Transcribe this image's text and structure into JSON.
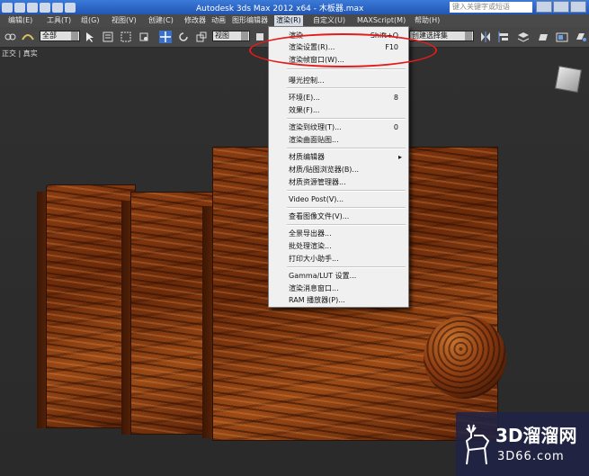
{
  "title_bar": {
    "app_title": "Autodesk 3ds Max  2012 x64     - 木板器.max",
    "search_placeholder": "键入关键字或短语"
  },
  "menu_bar": {
    "items": [
      "编辑(E)",
      "工具(T)",
      "组(G)",
      "视图(V)",
      "创建(C)",
      "修改器",
      "动画",
      "图形编辑器",
      "渲染(R)",
      "自定义(U)",
      "MAXScript(M)",
      "帮助(H)"
    ],
    "active": "渲染(R)"
  },
  "toolbar": {
    "selection_filter": "全部",
    "reference_coord": "视图",
    "named_selection": "创建选择集"
  },
  "viewport": {
    "label": "正交 | 真实"
  },
  "render_menu": {
    "groups": [
      [
        {
          "label": "渲染",
          "shortcut": "Shift+Q"
        },
        {
          "label": "渲染设置(R)...",
          "shortcut": "F10"
        },
        {
          "label": "渲染帧窗口(W)...",
          "shortcut": ""
        }
      ],
      [
        {
          "label": "曝光控制...",
          "shortcut": ""
        }
      ],
      [
        {
          "label": "环境(E)...",
          "shortcut": "8"
        },
        {
          "label": "效果(F)...",
          "shortcut": ""
        }
      ],
      [
        {
          "label": "渲染到纹理(T)...",
          "shortcut": "0"
        },
        {
          "label": "渲染曲面贴图...",
          "shortcut": ""
        }
      ],
      [
        {
          "label": "材质编辑器",
          "shortcut": "",
          "submenu": true
        },
        {
          "label": "材质/贴图浏览器(B)...",
          "shortcut": ""
        },
        {
          "label": "材质资源管理器...",
          "shortcut": ""
        }
      ],
      [
        {
          "label": "Video Post(V)...",
          "shortcut": ""
        }
      ],
      [
        {
          "label": "查看图像文件(V)...",
          "shortcut": ""
        }
      ],
      [
        {
          "label": "全景导出器...",
          "shortcut": ""
        },
        {
          "label": "批处理渲染...",
          "shortcut": ""
        },
        {
          "label": "打印大小助手...",
          "shortcut": ""
        }
      ],
      [
        {
          "label": "Gamma/LUT 设置...",
          "shortcut": ""
        },
        {
          "label": "渲染消息窗口...",
          "shortcut": ""
        },
        {
          "label": "RAM 播放器(P)...",
          "shortcut": ""
        }
      ]
    ]
  },
  "watermark": {
    "title": "3D溜溜网",
    "subtitle": "3D66.com"
  },
  "colors": {
    "highlight_ellipse": "#e31b1b",
    "menu_bg": "#f0f0f0",
    "title_bar": "#2256b5"
  }
}
